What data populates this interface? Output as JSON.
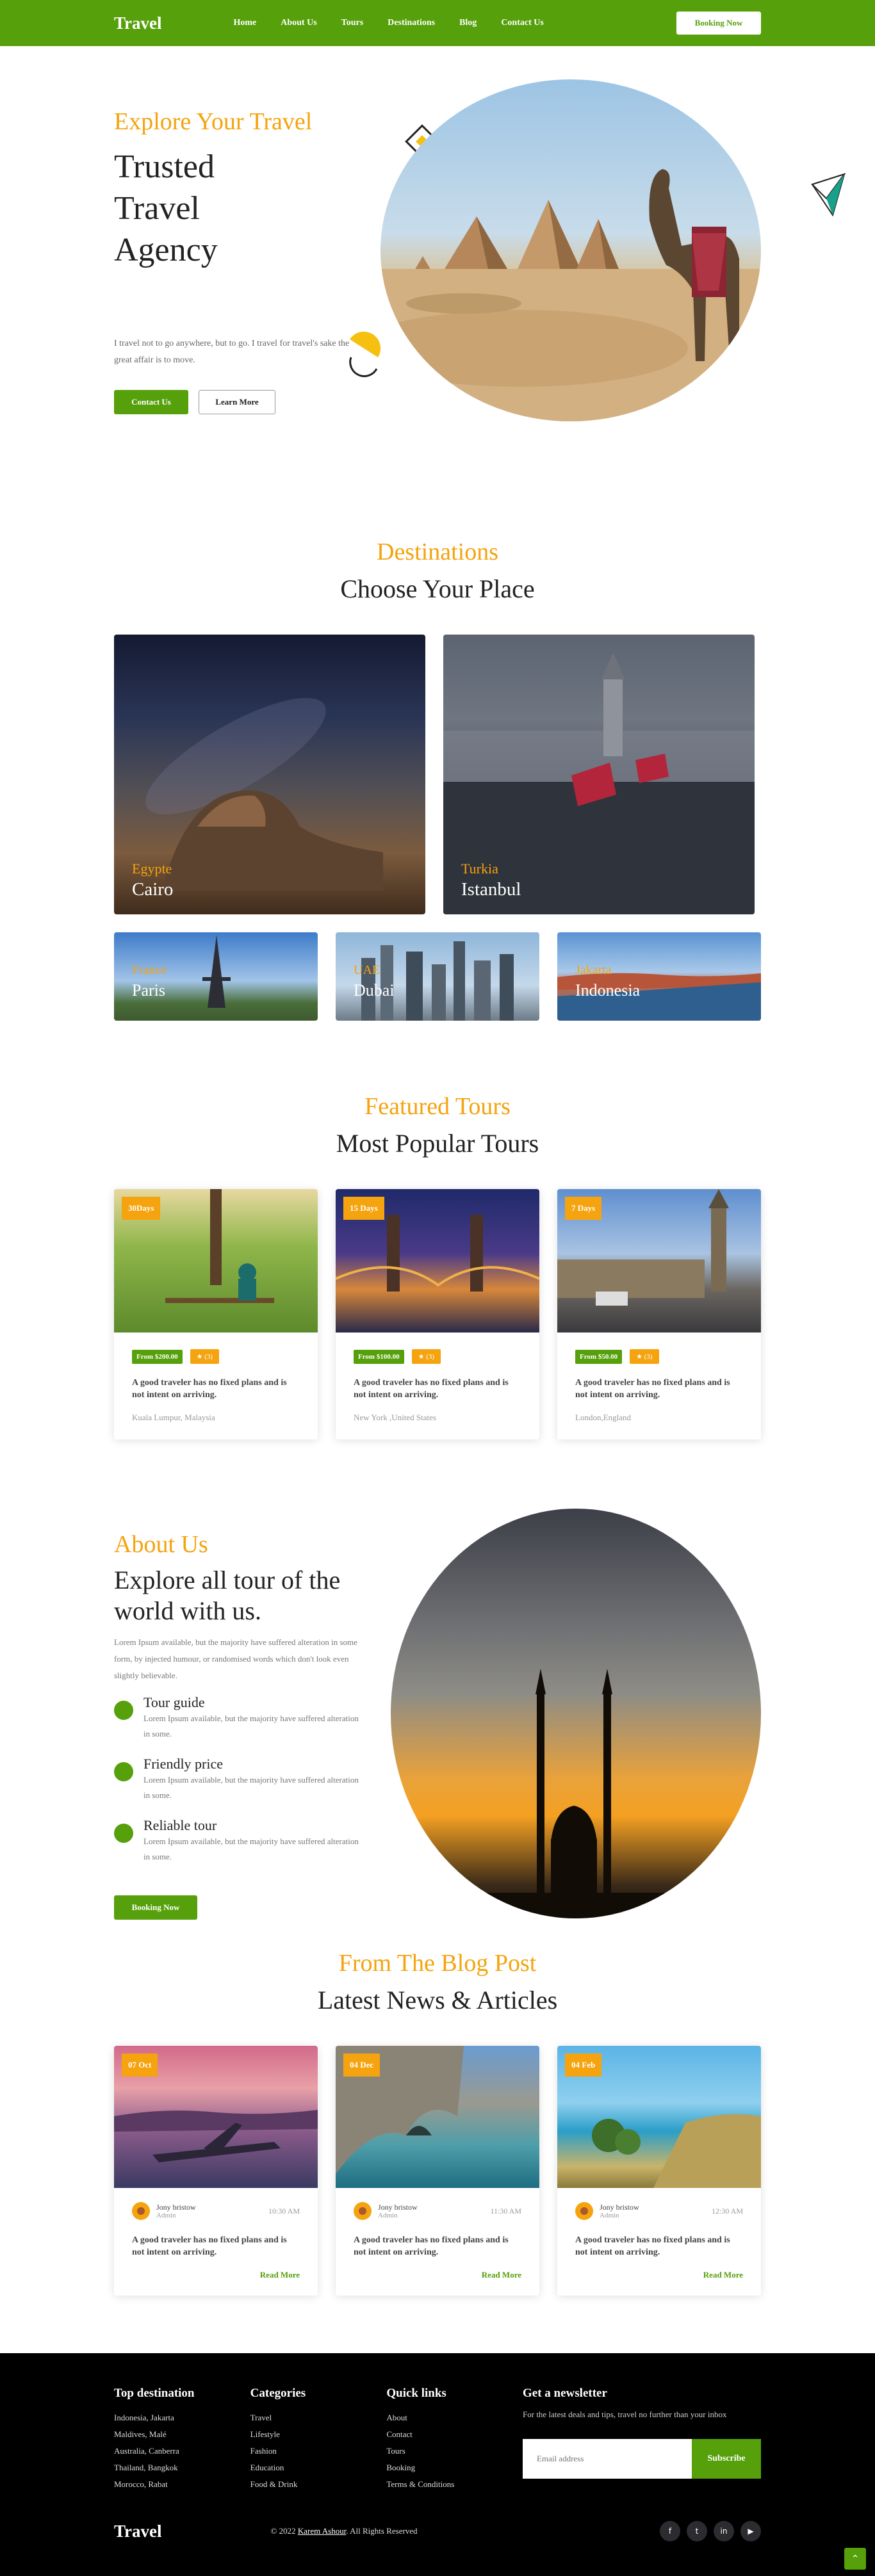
{
  "nav": {
    "logo": "Travel",
    "items": [
      {
        "label": "Home"
      },
      {
        "label": "About Us"
      },
      {
        "label": "Tours"
      },
      {
        "label": "Destinations"
      },
      {
        "label": "Blog"
      },
      {
        "label": "Contact Us"
      }
    ],
    "cta": "Booking Now"
  },
  "hero": {
    "eyebrow": "Explore Your Travel",
    "title": "Trusted Travel Agency",
    "text": "I travel not to go anywhere, but to go. I travel for travel's sake the great affair is to move.",
    "primary": "Contact Us",
    "secondary": "Learn More"
  },
  "destinations": {
    "eyebrow": "Destinations",
    "title": "Choose Your Place",
    "items": [
      {
        "country": "Egypte",
        "city": "Cairo"
      },
      {
        "country": "Turkia",
        "city": "Istanbul"
      },
      {
        "country": "France",
        "city": "Paris"
      },
      {
        "country": "UAE",
        "city": "Dubai"
      },
      {
        "country": "Jakarta",
        "city": "Indonesia"
      }
    ]
  },
  "tours": {
    "eyebrow": "Featured Tours",
    "title": "Most Popular Tours",
    "items": [
      {
        "tag": "30Days",
        "price": "From $200.00",
        "rating": "(3)",
        "desc": "A good traveler has no fixed plans and is not intent on arriving.",
        "location": "Kuala Lumpur, Malaysia"
      },
      {
        "tag": "15 Days",
        "price": "From $100.00",
        "rating": "(3)",
        "desc": "A good traveler has no fixed plans and is not intent on arriving.",
        "location": "New York ,United States"
      },
      {
        "tag": "7 Days",
        "price": "From $50.00",
        "rating": "(3)",
        "desc": "A good traveler has no fixed plans and is not intent on arriving.",
        "location": "London,England"
      }
    ]
  },
  "about": {
    "eyebrow": "About Us",
    "title": "Explore all tour of the world with us.",
    "text": "Lorem Ipsum available, but the majority have suffered alteration in some form, by injected humour, or randomised words which don't look even slightly believable.",
    "features": [
      {
        "title": "Tour guide",
        "text": "Lorem Ipsum available, but the majority have suffered alteration in some."
      },
      {
        "title": "Friendly price",
        "text": "Lorem Ipsum available, but the majority have suffered alteration in some."
      },
      {
        "title": "Reliable tour",
        "text": "Lorem Ipsum available, but the majority have suffered alteration in some."
      }
    ],
    "cta": "Booking Now"
  },
  "blog": {
    "eyebrow": "From The Blog Post",
    "title": "Latest News & Articles",
    "items": [
      {
        "tag": "07 Oct",
        "author": "Jony bristow",
        "role": "Admin",
        "time": "10:30 AM",
        "desc": "A good traveler has no fixed plans and is not intent on arriving.",
        "more": "Read More"
      },
      {
        "tag": "04 Dec",
        "author": "Jony bristow",
        "role": "Admin",
        "time": "11:30 AM",
        "desc": "A good traveler has no fixed plans and is not intent on arriving.",
        "more": "Read More"
      },
      {
        "tag": "04 Feb",
        "author": "Jony bristow",
        "role": "Admin",
        "time": "12:30 AM",
        "desc": "A good traveler has no fixed plans and is not intent on arriving.",
        "more": "Read More"
      }
    ]
  },
  "footer": {
    "col1": {
      "title": "Top destination",
      "items": [
        "Indonesia, Jakarta",
        "Maldives, Malé",
        "Australia, Canberra",
        "Thailand, Bangkok",
        "Morocco, Rabat"
      ]
    },
    "col2": {
      "title": "Categories",
      "items": [
        "Travel",
        "Lifestyle",
        "Fashion",
        "Education",
        "Food & Drink"
      ]
    },
    "col3": {
      "title": "Quick links",
      "items": [
        "About",
        "Contact",
        "Tours",
        "Booking",
        "Terms & Conditions"
      ]
    },
    "news": {
      "title": "Get a newsletter",
      "text": "For the latest deals and tips, travel no further than your inbox",
      "placeholder": "Email address",
      "button": "Subscribe"
    },
    "logo": "Travel",
    "copy_pre": "© 2022",
    "copy_name": "Karem Ashour",
    "copy_post": ". All Rights Reserved",
    "social": [
      {
        "icon": "facebook-icon",
        "glyph": "f"
      },
      {
        "icon": "twitter-icon",
        "glyph": "t"
      },
      {
        "icon": "linkedin-icon",
        "glyph": "in"
      },
      {
        "icon": "youtube-icon",
        "glyph": "▶"
      }
    ],
    "totop": "⌃"
  },
  "colors": {
    "brand_green": "#55a00b",
    "accent_orange": "#f5a30e"
  }
}
